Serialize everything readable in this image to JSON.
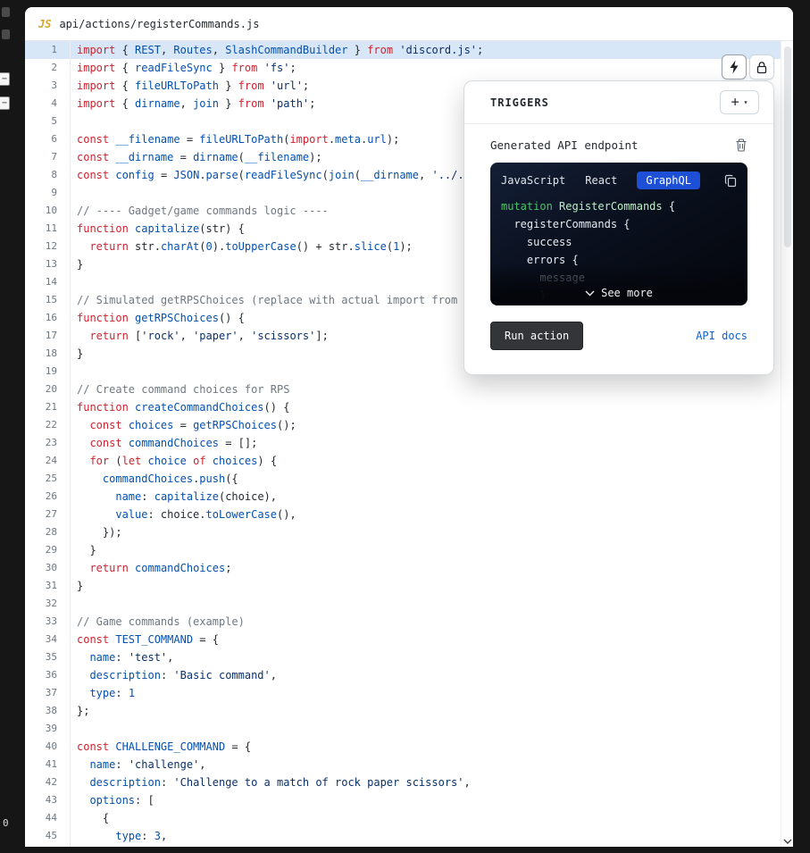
{
  "file_tab": {
    "icon": "JS",
    "title": "api/actions/registerCommands.js"
  },
  "left_rail": {
    "zoom_top": "−",
    "zoom_bottom": "−",
    "bottom_label": "0"
  },
  "colors": {
    "active_tab_bg": "#1d4fd7",
    "link": "#0b63ce",
    "keyword": "#cf222e",
    "identifier": "#0550ae",
    "string": "#0a3069",
    "comment": "#6e7781",
    "line_highlight": "#d8e7f8",
    "mutation_green": "#4cc26a"
  },
  "editor": {
    "lines": [
      {
        "n": 1,
        "hl": true,
        "t": [
          [
            "k",
            "import"
          ],
          [
            "p",
            " { "
          ],
          [
            "i",
            "REST"
          ],
          [
            "p",
            ", "
          ],
          [
            "i",
            "Routes"
          ],
          [
            "p",
            ", "
          ],
          [
            "i",
            "SlashCommandBuilder"
          ],
          [
            "p",
            " } "
          ],
          [
            "k",
            "from"
          ],
          [
            "p",
            " "
          ],
          [
            "s",
            "'discord.js'"
          ],
          [
            "p",
            ";"
          ]
        ]
      },
      {
        "n": 2,
        "t": [
          [
            "k",
            "import"
          ],
          [
            "p",
            " { "
          ],
          [
            "i",
            "readFileSync"
          ],
          [
            "p",
            " } "
          ],
          [
            "k",
            "from"
          ],
          [
            "p",
            " "
          ],
          [
            "s",
            "'fs'"
          ],
          [
            "p",
            ";"
          ]
        ]
      },
      {
        "n": 3,
        "t": [
          [
            "k",
            "import"
          ],
          [
            "p",
            " { "
          ],
          [
            "i",
            "fileURLToPath"
          ],
          [
            "p",
            " } "
          ],
          [
            "k",
            "from"
          ],
          [
            "p",
            " "
          ],
          [
            "s",
            "'url'"
          ],
          [
            "p",
            ";"
          ]
        ]
      },
      {
        "n": 4,
        "t": [
          [
            "k",
            "import"
          ],
          [
            "p",
            " { "
          ],
          [
            "i",
            "dirname"
          ],
          [
            "p",
            ", "
          ],
          [
            "i",
            "join"
          ],
          [
            "p",
            " } "
          ],
          [
            "k",
            "from"
          ],
          [
            "p",
            " "
          ],
          [
            "s",
            "'path'"
          ],
          [
            "p",
            ";"
          ]
        ]
      },
      {
        "n": 5,
        "t": []
      },
      {
        "n": 6,
        "t": [
          [
            "k",
            "const"
          ],
          [
            "p",
            " "
          ],
          [
            "i",
            "__filename"
          ],
          [
            "p",
            " = "
          ],
          [
            "i",
            "fileURLToPath"
          ],
          [
            "p",
            "("
          ],
          [
            "k",
            "import"
          ],
          [
            "p",
            "."
          ],
          [
            "i",
            "meta"
          ],
          [
            "p",
            "."
          ],
          [
            "i",
            "url"
          ],
          [
            "p",
            ");"
          ]
        ]
      },
      {
        "n": 7,
        "t": [
          [
            "k",
            "const"
          ],
          [
            "p",
            " "
          ],
          [
            "i",
            "__dirname"
          ],
          [
            "p",
            " = "
          ],
          [
            "i",
            "dirname"
          ],
          [
            "p",
            "("
          ],
          [
            "i",
            "__filename"
          ],
          [
            "p",
            ");"
          ]
        ]
      },
      {
        "n": 8,
        "t": [
          [
            "k",
            "const"
          ],
          [
            "p",
            " "
          ],
          [
            "i",
            "config"
          ],
          [
            "p",
            " = "
          ],
          [
            "i",
            "JSON"
          ],
          [
            "p",
            "."
          ],
          [
            "i",
            "parse"
          ],
          [
            "p",
            "("
          ],
          [
            "i",
            "readFileSync"
          ],
          [
            "p",
            "("
          ],
          [
            "i",
            "join"
          ],
          [
            "p",
            "("
          ],
          [
            "i",
            "__dirname"
          ],
          [
            "p",
            ", "
          ],
          [
            "s",
            "'../../"
          ]
        ]
      },
      {
        "n": 9,
        "t": []
      },
      {
        "n": 10,
        "t": [
          [
            "c",
            "// ---- Gadget/game commands logic ----"
          ]
        ]
      },
      {
        "n": 11,
        "t": [
          [
            "k",
            "function"
          ],
          [
            "p",
            " "
          ],
          [
            "i",
            "capitalize"
          ],
          [
            "p",
            "(str) {"
          ]
        ]
      },
      {
        "n": 12,
        "t": [
          [
            "p",
            "  "
          ],
          [
            "k",
            "return"
          ],
          [
            "p",
            " str."
          ],
          [
            "i",
            "charAt"
          ],
          [
            "p",
            "("
          ],
          [
            "n",
            "0"
          ],
          [
            "p",
            ")."
          ],
          [
            "i",
            "toUpperCase"
          ],
          [
            "p",
            "() + str."
          ],
          [
            "i",
            "slice"
          ],
          [
            "p",
            "("
          ],
          [
            "n",
            "1"
          ],
          [
            "p",
            ");"
          ]
        ]
      },
      {
        "n": 13,
        "t": [
          [
            "p",
            "}"
          ]
        ]
      },
      {
        "n": 14,
        "t": []
      },
      {
        "n": 15,
        "t": [
          [
            "c",
            "// Simulated getRPSChoices (replace with actual import from yo"
          ]
        ]
      },
      {
        "n": 16,
        "t": [
          [
            "k",
            "function"
          ],
          [
            "p",
            " "
          ],
          [
            "i",
            "getRPSChoices"
          ],
          [
            "p",
            "() {"
          ]
        ]
      },
      {
        "n": 17,
        "t": [
          [
            "p",
            "  "
          ],
          [
            "k",
            "return"
          ],
          [
            "p",
            " ["
          ],
          [
            "s",
            "'rock'"
          ],
          [
            "p",
            ", "
          ],
          [
            "s",
            "'paper'"
          ],
          [
            "p",
            ", "
          ],
          [
            "s",
            "'scissors'"
          ],
          [
            "p",
            "];"
          ]
        ]
      },
      {
        "n": 18,
        "t": [
          [
            "p",
            "}"
          ]
        ]
      },
      {
        "n": 19,
        "t": []
      },
      {
        "n": 20,
        "t": [
          [
            "c",
            "// Create command choices for RPS"
          ]
        ]
      },
      {
        "n": 21,
        "t": [
          [
            "k",
            "function"
          ],
          [
            "p",
            " "
          ],
          [
            "i",
            "createCommandChoices"
          ],
          [
            "p",
            "() {"
          ]
        ]
      },
      {
        "n": 22,
        "t": [
          [
            "p",
            "  "
          ],
          [
            "k",
            "const"
          ],
          [
            "p",
            " "
          ],
          [
            "i",
            "choices"
          ],
          [
            "p",
            " = "
          ],
          [
            "i",
            "getRPSChoices"
          ],
          [
            "p",
            "();"
          ]
        ]
      },
      {
        "n": 23,
        "t": [
          [
            "p",
            "  "
          ],
          [
            "k",
            "const"
          ],
          [
            "p",
            " "
          ],
          [
            "i",
            "commandChoices"
          ],
          [
            "p",
            " = [];"
          ]
        ]
      },
      {
        "n": 24,
        "t": [
          [
            "p",
            "  "
          ],
          [
            "k",
            "for"
          ],
          [
            "p",
            " ("
          ],
          [
            "k",
            "let"
          ],
          [
            "p",
            " "
          ],
          [
            "i",
            "choice"
          ],
          [
            "p",
            " "
          ],
          [
            "k",
            "of"
          ],
          [
            "p",
            " "
          ],
          [
            "i",
            "choices"
          ],
          [
            "p",
            ") {"
          ]
        ]
      },
      {
        "n": 25,
        "t": [
          [
            "p",
            "    "
          ],
          [
            "i",
            "commandChoices"
          ],
          [
            "p",
            "."
          ],
          [
            "i",
            "push"
          ],
          [
            "p",
            "({"
          ]
        ]
      },
      {
        "n": 26,
        "t": [
          [
            "p",
            "      "
          ],
          [
            "i",
            "name"
          ],
          [
            "p",
            ": "
          ],
          [
            "i",
            "capitalize"
          ],
          [
            "p",
            "(choice),"
          ]
        ]
      },
      {
        "n": 27,
        "t": [
          [
            "p",
            "      "
          ],
          [
            "i",
            "value"
          ],
          [
            "p",
            ": choice."
          ],
          [
            "i",
            "toLowerCase"
          ],
          [
            "p",
            "(),"
          ]
        ]
      },
      {
        "n": 28,
        "t": [
          [
            "p",
            "    });"
          ]
        ]
      },
      {
        "n": 29,
        "t": [
          [
            "p",
            "  }"
          ]
        ]
      },
      {
        "n": 30,
        "t": [
          [
            "p",
            "  "
          ],
          [
            "k",
            "return"
          ],
          [
            "p",
            " "
          ],
          [
            "i",
            "commandChoices"
          ],
          [
            "p",
            ";"
          ]
        ]
      },
      {
        "n": 31,
        "t": [
          [
            "p",
            "}"
          ]
        ]
      },
      {
        "n": 32,
        "t": []
      },
      {
        "n": 33,
        "t": [
          [
            "c",
            "// Game commands (example)"
          ]
        ]
      },
      {
        "n": 34,
        "t": [
          [
            "k",
            "const"
          ],
          [
            "p",
            " "
          ],
          [
            "i",
            "TEST_COMMAND"
          ],
          [
            "p",
            " = {"
          ]
        ]
      },
      {
        "n": 35,
        "t": [
          [
            "p",
            "  "
          ],
          [
            "i",
            "name"
          ],
          [
            "p",
            ": "
          ],
          [
            "s",
            "'test'"
          ],
          [
            "p",
            ","
          ]
        ]
      },
      {
        "n": 36,
        "t": [
          [
            "p",
            "  "
          ],
          [
            "i",
            "description"
          ],
          [
            "p",
            ": "
          ],
          [
            "s",
            "'Basic command'"
          ],
          [
            "p",
            ","
          ]
        ]
      },
      {
        "n": 37,
        "t": [
          [
            "p",
            "  "
          ],
          [
            "i",
            "type"
          ],
          [
            "p",
            ": "
          ],
          [
            "n",
            "1"
          ]
        ]
      },
      {
        "n": 38,
        "t": [
          [
            "p",
            "};"
          ]
        ]
      },
      {
        "n": 39,
        "t": []
      },
      {
        "n": 40,
        "t": [
          [
            "k",
            "const"
          ],
          [
            "p",
            " "
          ],
          [
            "i",
            "CHALLENGE_COMMAND"
          ],
          [
            "p",
            " = {"
          ]
        ]
      },
      {
        "n": 41,
        "t": [
          [
            "p",
            "  "
          ],
          [
            "i",
            "name"
          ],
          [
            "p",
            ": "
          ],
          [
            "s",
            "'challenge'"
          ],
          [
            "p",
            ","
          ]
        ]
      },
      {
        "n": 42,
        "t": [
          [
            "p",
            "  "
          ],
          [
            "i",
            "description"
          ],
          [
            "p",
            ": "
          ],
          [
            "s",
            "'Challenge to a match of rock paper scissors'"
          ],
          [
            "p",
            ","
          ]
        ]
      },
      {
        "n": 43,
        "t": [
          [
            "p",
            "  "
          ],
          [
            "i",
            "options"
          ],
          [
            "p",
            ": ["
          ]
        ]
      },
      {
        "n": 44,
        "t": [
          [
            "p",
            "    {"
          ]
        ]
      },
      {
        "n": 45,
        "t": [
          [
            "p",
            "      "
          ],
          [
            "i",
            "type"
          ],
          [
            "p",
            ": "
          ],
          [
            "n",
            "3"
          ],
          [
            "p",
            ","
          ]
        ]
      }
    ]
  },
  "triggers": {
    "title": "TRIGGERS",
    "add_button": {
      "plus": "+",
      "caret": "▾"
    },
    "endpoint_title": "Generated API endpoint",
    "tabs": [
      {
        "label": "JavaScript",
        "active": false
      },
      {
        "label": "React",
        "active": false
      },
      {
        "label": "GraphQL",
        "active": true
      }
    ],
    "code_lines": [
      {
        "t": [
          [
            "g",
            "mutation"
          ],
          [
            "w",
            " "
          ],
          [
            "n",
            "RegisterCommands"
          ],
          [
            "w",
            " {"
          ]
        ]
      },
      {
        "t": [
          [
            "w",
            "  registerCommands {"
          ]
        ]
      },
      {
        "t": [
          [
            "w",
            "    success"
          ]
        ]
      },
      {
        "t": [
          [
            "w",
            "    errors {"
          ]
        ]
      },
      {
        "t": [
          [
            "d",
            "      message"
          ]
        ]
      },
      {
        "t": [
          [
            "d",
            "      }"
          ]
        ]
      }
    ],
    "see_more": "See more",
    "run_button": "Run action",
    "api_docs": "API docs"
  }
}
